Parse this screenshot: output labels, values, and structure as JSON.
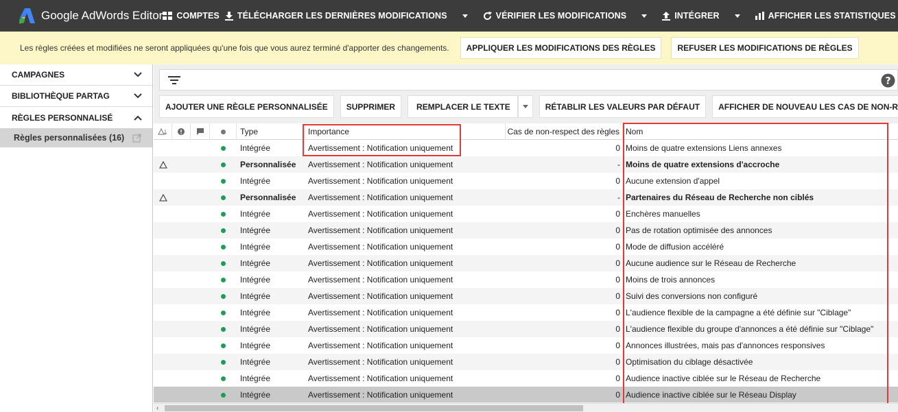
{
  "app": {
    "title": "Google AdWords Editor"
  },
  "toolbar": {
    "accounts": "COMPTES",
    "download": "TÉLÉCHARGER LES DERNIÈRES MODIFICATIONS",
    "verify": "VÉRIFIER LES MODIFICATIONS",
    "integrate": "INTÉGRER",
    "stats": "AFFICHER LES STATISTIQUES"
  },
  "notice": {
    "text": "Les règles créées et modifiées ne seront appliquées qu'une fois que vous aurez terminé d'apporter des changements.",
    "apply_label": "APPLIQUER LES MODIFICATIONS DES RÈGLES",
    "reject_label": "REFUSER LES MODIFICATIONS DE RÈGLES"
  },
  "sidebar": {
    "sections": [
      {
        "label": "CAMPAGNES"
      },
      {
        "label": "BIBLIOTHÈQUE PARTAG"
      },
      {
        "label": "RÈGLES PERSONNALISÉ"
      }
    ],
    "selected_item": "Règles personnalisées (16)"
  },
  "actions": {
    "add": "AJOUTER UNE RÈGLE PERSONNALISÉE",
    "delete": "SUPPRIMER",
    "replace": "REMPLACER LE TEXTE",
    "reset": "RÉTABLIR LES VALEURS PAR DÉFAUT",
    "show": "AFFICHER DE NOUVEAU LES CAS DE NON-RESPE"
  },
  "table": {
    "headers": {
      "type": "Type",
      "importance": "Importance",
      "violations": "Cas de non-respect des règles",
      "name": "Nom"
    },
    "rows": [
      {
        "warn": false,
        "type": "Intégrée",
        "importance": "Avertissement : Notification uniquement",
        "violations": "0",
        "name": "Moins de quatre extensions Liens annexes",
        "bold": false
      },
      {
        "warn": true,
        "type": "Personnalisée",
        "importance": "Avertissement : Notification uniquement",
        "violations": "-",
        "name": "Moins de quatre extensions d'accroche",
        "bold": true
      },
      {
        "warn": false,
        "type": "Intégrée",
        "importance": "Avertissement : Notification uniquement",
        "violations": "0",
        "name": "Aucune extension d'appel",
        "bold": false
      },
      {
        "warn": true,
        "type": "Personnalisée",
        "importance": "Avertissement : Notification uniquement",
        "violations": "-",
        "name": "Partenaires du Réseau de Recherche non ciblés",
        "bold": true
      },
      {
        "warn": false,
        "type": "Intégrée",
        "importance": "Avertissement : Notification uniquement",
        "violations": "0",
        "name": "Enchères manuelles",
        "bold": false
      },
      {
        "warn": false,
        "type": "Intégrée",
        "importance": "Avertissement : Notification uniquement",
        "violations": "0",
        "name": "Pas de rotation optimisée des annonces",
        "bold": false
      },
      {
        "warn": false,
        "type": "Intégrée",
        "importance": "Avertissement : Notification uniquement",
        "violations": "0",
        "name": "Mode de diffusion accéléré",
        "bold": false
      },
      {
        "warn": false,
        "type": "Intégrée",
        "importance": "Avertissement : Notification uniquement",
        "violations": "0",
        "name": "Aucune audience sur le Réseau de Recherche",
        "bold": false
      },
      {
        "warn": false,
        "type": "Intégrée",
        "importance": "Avertissement : Notification uniquement",
        "violations": "0",
        "name": "Moins de trois annonces",
        "bold": false
      },
      {
        "warn": false,
        "type": "Intégrée",
        "importance": "Avertissement : Notification uniquement",
        "violations": "0",
        "name": "Suivi des conversions non configuré",
        "bold": false
      },
      {
        "warn": false,
        "type": "Intégrée",
        "importance": "Avertissement : Notification uniquement",
        "violations": "0",
        "name": "L'audience flexible de la campagne a été définie sur \"Ciblage\"",
        "bold": false
      },
      {
        "warn": false,
        "type": "Intégrée",
        "importance": "Avertissement : Notification uniquement",
        "violations": "0",
        "name": "L'audience flexible du groupe d'annonces a été définie sur \"Ciblage\"",
        "bold": false
      },
      {
        "warn": false,
        "type": "Intégrée",
        "importance": "Avertissement : Notification uniquement",
        "violations": "0",
        "name": "Annonces illustrées, mais pas d'annonces responsives",
        "bold": false
      },
      {
        "warn": false,
        "type": "Intégrée",
        "importance": "Avertissement : Notification uniquement",
        "violations": "0",
        "name": "Optimisation du ciblage désactivée",
        "bold": false
      },
      {
        "warn": false,
        "type": "Intégrée",
        "importance": "Avertissement : Notification uniquement",
        "violations": "0",
        "name": "Audience inactive ciblée sur le Réseau de Recherche",
        "bold": false
      },
      {
        "warn": false,
        "type": "Intégrée",
        "importance": "Avertissement : Notification uniquement",
        "violations": "0",
        "name": "Audience inactive ciblée sur le Réseau Display",
        "bold": false
      }
    ]
  },
  "colors": {
    "accent_red": "#e53935",
    "status_green": "#1f9d55",
    "notice_bg": "#fdf6c6",
    "topbar_bg": "#3c3c3c"
  }
}
